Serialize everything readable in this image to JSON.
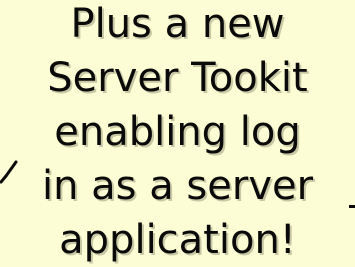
{
  "slide": {
    "lines": [
      "Plus a new",
      "Server Tookit",
      "enabling log",
      "in as a server",
      "application!"
    ]
  },
  "colors": {
    "background": "#fdfdd5",
    "text": "#0a0a0a",
    "shadow": "#c8c8a6"
  },
  "icons": {
    "left_mark": "checkmark-icon",
    "right_mark": "dash-icon"
  }
}
